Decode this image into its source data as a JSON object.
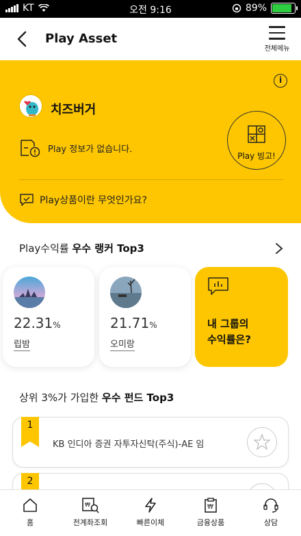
{
  "status": {
    "carrier": "KT",
    "time": "오전 9:16",
    "battery": "89%",
    "battery_level": 0.89
  },
  "header": {
    "title": "Play Asset",
    "menu_label": "전체메뉴"
  },
  "hero": {
    "nickname": "치즈버거",
    "no_info": "Play 정보가 없습니다.",
    "bingo_label": "Play 빙고!",
    "what_play": "Play상품이란 무엇인가요?",
    "info_glyph": "i"
  },
  "rankers": {
    "title_prefix": "Play수익률 ",
    "title_bold": "우수 랭커 Top3",
    "items": [
      {
        "pct": "22.31",
        "unit": "%",
        "name": "립밤"
      },
      {
        "pct": "21.71",
        "unit": "%",
        "name": "오미랑"
      }
    ],
    "group_line1": "내 그룹의",
    "group_line2": "수익률은?"
  },
  "funds": {
    "title_prefix": "상위 3%가 가입한 ",
    "title_bold": "우수 펀드 Top3",
    "items": [
      {
        "rank": "1",
        "name": "KB 인디아 증권 자투자신탁(주식)-AE 임"
      },
      {
        "rank": "2",
        "name": ""
      }
    ]
  },
  "tabs": [
    {
      "label": "홈",
      "icon": "home-icon"
    },
    {
      "label": "전계좌조회",
      "icon": "account-search-icon"
    },
    {
      "label": "빠른이체",
      "icon": "lightning-icon"
    },
    {
      "label": "금융상품",
      "icon": "financial-product-icon"
    },
    {
      "label": "상담",
      "icon": "headset-icon"
    }
  ],
  "colors": {
    "accent": "#fdc600",
    "battery": "#2ecc40"
  }
}
